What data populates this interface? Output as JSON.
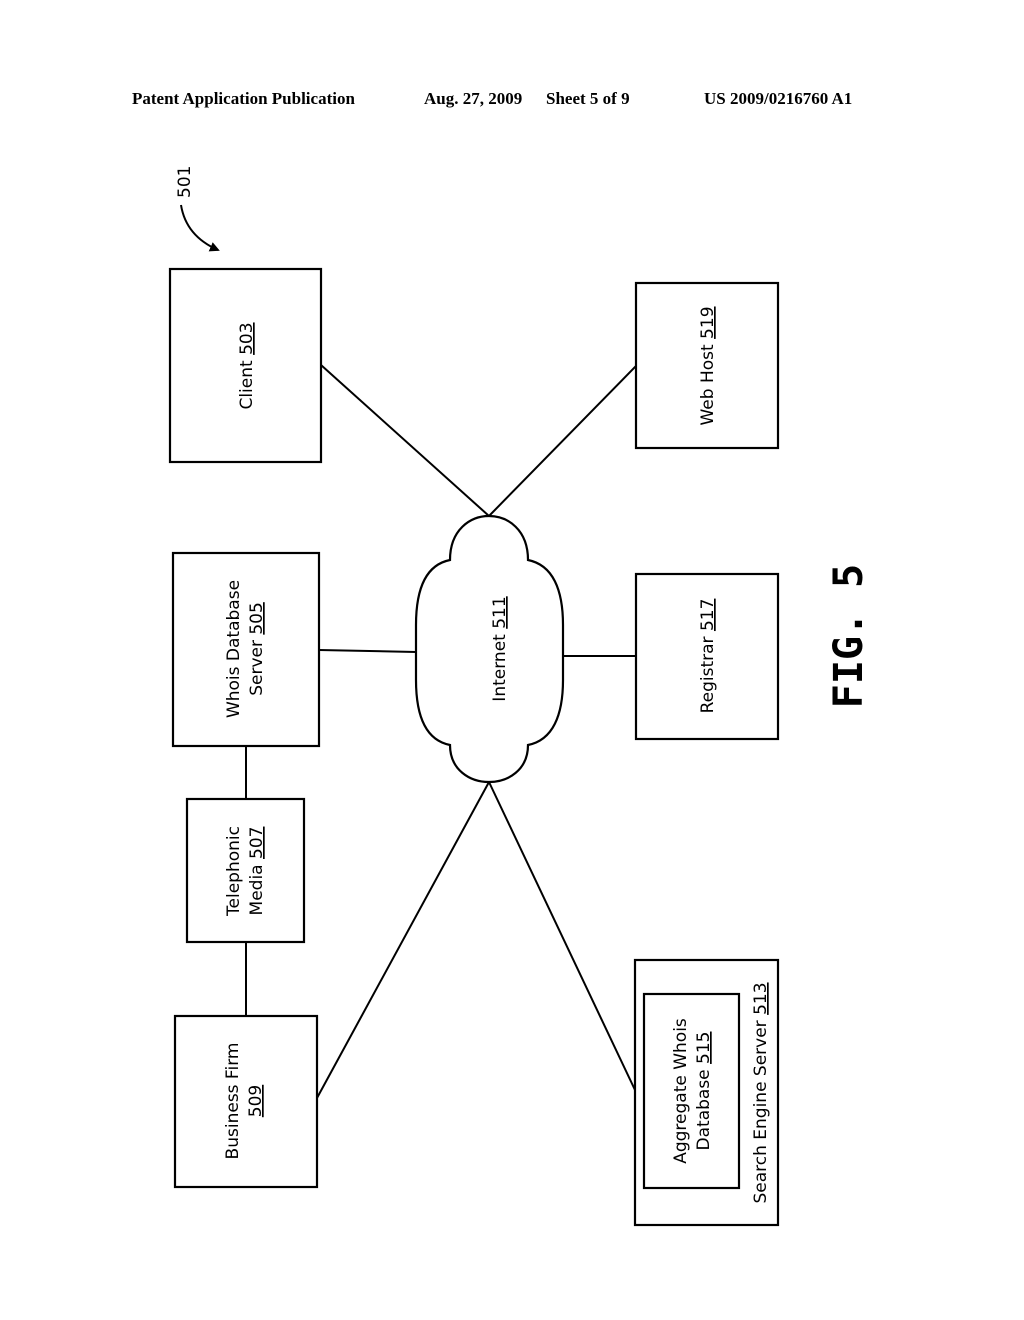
{
  "header": {
    "left": "Patent Application Publication",
    "date": "Aug. 27, 2009",
    "sheet": "Sheet 5 of 9",
    "number": "US 2009/0216760 A1"
  },
  "figure": {
    "label": "FIG. 5",
    "system_ref": "501"
  },
  "nodes": {
    "client": {
      "name": "Client",
      "ref": "503"
    },
    "whois": {
      "line1": "Whois Database",
      "line2": "Server",
      "ref": "505"
    },
    "telephonic": {
      "line1": "Telephonic",
      "line2": "Media",
      "ref": "507"
    },
    "business": {
      "line1": "Business Firm",
      "ref": "509"
    },
    "internet": {
      "name": "Internet",
      "ref": "511"
    },
    "search": {
      "name": "Search Engine Server",
      "ref": "513"
    },
    "aggregate": {
      "line1": "Aggregate Whois",
      "line2": "Database",
      "ref": "515"
    },
    "registrar": {
      "name": "Registrar",
      "ref": "517"
    },
    "webhost": {
      "name": "Web Host",
      "ref": "519"
    }
  }
}
